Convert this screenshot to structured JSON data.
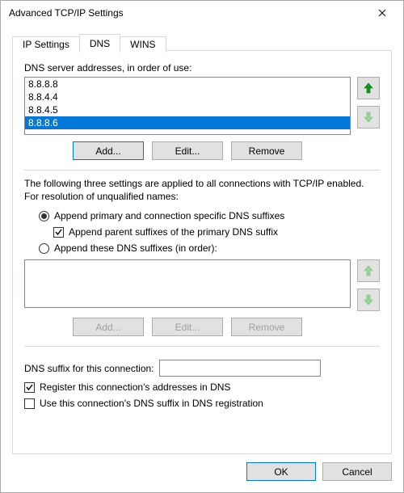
{
  "window": {
    "title": "Advanced TCP/IP Settings"
  },
  "tabs": {
    "ip": "IP Settings",
    "dns": "DNS",
    "wins": "WINS"
  },
  "dns": {
    "listLabel": "DNS server addresses, in order of use:",
    "servers": [
      "8.8.8.8",
      "8.8.4.4",
      "8.8.4.5",
      "8.8.8.6"
    ],
    "selectedIndex": 3,
    "add": "Add...",
    "edit": "Edit...",
    "remove": "Remove",
    "desc": "The following three settings are applied to all connections with TCP/IP enabled. For resolution of unqualified names:",
    "radio1": "Append primary and connection specific DNS suffixes",
    "chkParent": "Append parent suffixes of the primary DNS suffix",
    "radio2": "Append these DNS suffixes (in order):",
    "suffAdd": "Add...",
    "suffEdit": "Edit...",
    "suffRemove": "Remove",
    "suffixFieldLabel": "DNS suffix for this connection:",
    "suffixFieldValue": "",
    "chkRegister": "Register this connection's addresses in DNS",
    "chkUseSuffix": "Use this connection's DNS suffix in DNS registration"
  },
  "buttons": {
    "ok": "OK",
    "cancel": "Cancel"
  },
  "colors": {
    "selection": "#0078d7"
  }
}
